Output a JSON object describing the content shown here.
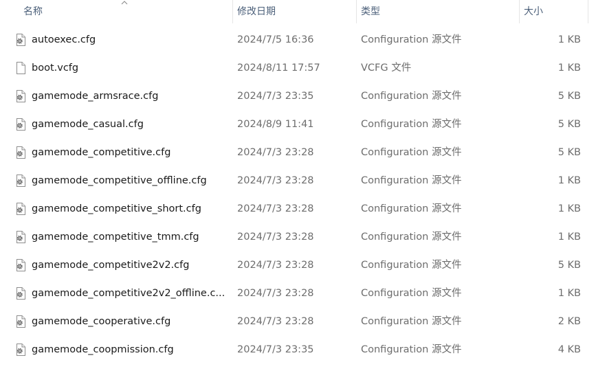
{
  "columns": {
    "name": "名称",
    "date": "修改日期",
    "type": "类型",
    "size": "大小"
  },
  "files": [
    {
      "name": "autoexec.cfg",
      "date": "2024/7/5 16:36",
      "type": "Configuration 源文件",
      "size": "1 KB",
      "icon": "config-file-icon"
    },
    {
      "name": "boot.vcfg",
      "date": "2024/8/11 17:57",
      "type": "VCFG 文件",
      "size": "1 KB",
      "icon": "blank-file-icon"
    },
    {
      "name": "gamemode_armsrace.cfg",
      "date": "2024/7/3 23:35",
      "type": "Configuration 源文件",
      "size": "5 KB",
      "icon": "config-file-icon"
    },
    {
      "name": "gamemode_casual.cfg",
      "date": "2024/8/9 11:41",
      "type": "Configuration 源文件",
      "size": "5 KB",
      "icon": "config-file-icon"
    },
    {
      "name": "gamemode_competitive.cfg",
      "date": "2024/7/3 23:28",
      "type": "Configuration 源文件",
      "size": "5 KB",
      "icon": "config-file-icon"
    },
    {
      "name": "gamemode_competitive_offline.cfg",
      "date": "2024/7/3 23:28",
      "type": "Configuration 源文件",
      "size": "1 KB",
      "icon": "config-file-icon"
    },
    {
      "name": "gamemode_competitive_short.cfg",
      "date": "2024/7/3 23:28",
      "type": "Configuration 源文件",
      "size": "1 KB",
      "icon": "config-file-icon"
    },
    {
      "name": "gamemode_competitive_tmm.cfg",
      "date": "2024/7/3 23:28",
      "type": "Configuration 源文件",
      "size": "1 KB",
      "icon": "config-file-icon"
    },
    {
      "name": "gamemode_competitive2v2.cfg",
      "date": "2024/7/3 23:28",
      "type": "Configuration 源文件",
      "size": "5 KB",
      "icon": "config-file-icon"
    },
    {
      "name": "gamemode_competitive2v2_offline.c...",
      "date": "2024/7/3 23:28",
      "type": "Configuration 源文件",
      "size": "1 KB",
      "icon": "config-file-icon"
    },
    {
      "name": "gamemode_cooperative.cfg",
      "date": "2024/7/3 23:28",
      "type": "Configuration 源文件",
      "size": "2 KB",
      "icon": "config-file-icon"
    },
    {
      "name": "gamemode_coopmission.cfg",
      "date": "2024/7/3 23:35",
      "type": "Configuration 源文件",
      "size": "4 KB",
      "icon": "config-file-icon"
    }
  ]
}
